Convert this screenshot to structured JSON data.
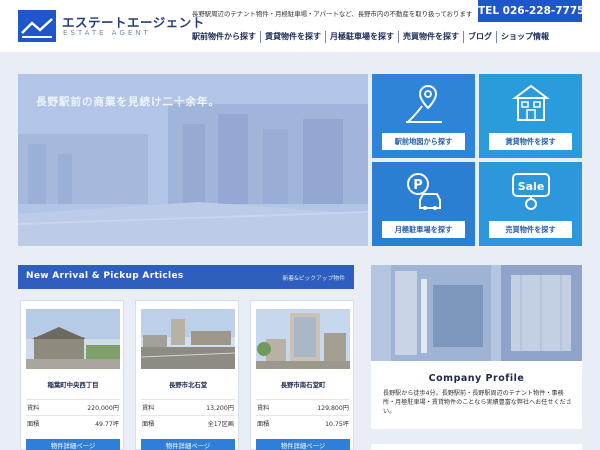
{
  "header": {
    "logo_jp": "エステートエージェント",
    "logo_en": "ESTATE AGENT",
    "tagline": "長野駅周辺のテナント物件・月極駐車場・アパートなど、長野市内の不動産を取り扱っております",
    "tel": "TEL 026-228-7775",
    "nav": [
      "駅前物件から探す",
      "賃貸物件を探す",
      "月極駐車場を探す",
      "売買物件を探す",
      "ブログ",
      "ショップ情報"
    ]
  },
  "hero": {
    "caption": "長野駅前の商業を見続け二十余年。"
  },
  "tiles": [
    {
      "icon": "map-pin-icon",
      "label": "駅前地図から探す"
    },
    {
      "icon": "house-icon",
      "label": "賃貸物件を探す"
    },
    {
      "icon": "parking-car-icon",
      "label": "月極駐車場を探す"
    },
    {
      "icon": "sale-tag-icon",
      "label": "売買物件を探す"
    }
  ],
  "arrival": {
    "title": "New Arrival & Pickup Articles",
    "subtitle": "新着&ピックアップ物件",
    "cards": [
      {
        "name": "稲葉町中央西丁目",
        "rent_label": "賃料",
        "rent": "220,000円",
        "area_label": "面積",
        "area": "49.77坪",
        "button": "物件詳細ページ"
      },
      {
        "name": "長野市北石堂",
        "rent_label": "賃料",
        "rent": "13,200円",
        "area_label": "面積",
        "area": "全17区画",
        "button": "物件詳細ページ"
      },
      {
        "name": "長野市南石堂町",
        "rent_label": "賃料",
        "rent": "129,800円",
        "area_label": "面積",
        "area": "10.75坪",
        "button": "物件詳細ページ"
      }
    ]
  },
  "company": {
    "title": "Company Profile",
    "text": "長野駅から徒歩4分。長野駅前・長野駅周辺のテナント物件・事務所・月極駐車場・賃貸物件のことなら実績豊富な弊社へお任せください。"
  },
  "colors": {
    "brand_blue": "#1f56c9",
    "tile_blue": "#2e84d9",
    "section_head": "#2e5fbd"
  }
}
